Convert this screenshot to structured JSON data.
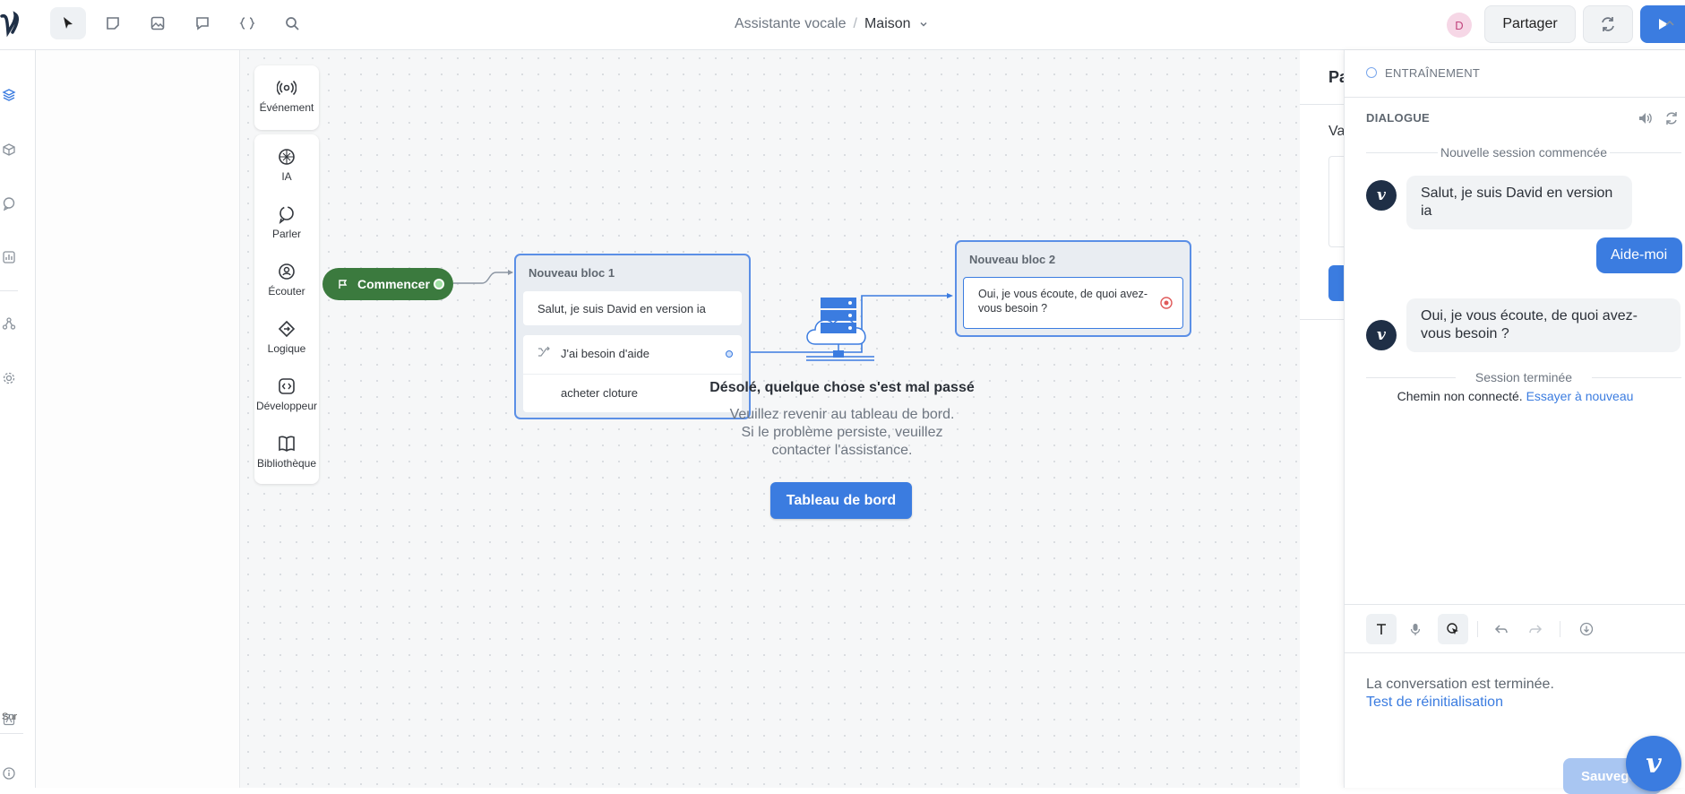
{
  "toolbar": {
    "tools": [
      "select-tool",
      "note-tool",
      "image-tool",
      "comment-tool",
      "variables-tool",
      "search-tool"
    ]
  },
  "breadcrumb": {
    "project": "Assistante vocale",
    "separator": "/",
    "flow": "Maison"
  },
  "header": {
    "avatar_initial": "D",
    "share_label": "Partager"
  },
  "left_rail": {
    "bottom_label": "Sur"
  },
  "palette": {
    "event": "Événement",
    "items": [
      "IA",
      "Parler",
      "Écouter",
      "Logique",
      "Développeur",
      "Bibliothèque"
    ]
  },
  "canvas": {
    "start_label": "Commencer",
    "block1": {
      "title": "Nouveau bloc 1",
      "message": "Salut, je suis David en version ia",
      "intent1": "J'ai besoin d'aide",
      "intent2": "acheter cloture"
    },
    "block2": {
      "title": "Nouveau bloc 2",
      "message": "Oui, je vous écoute, de quoi avez-vous besoin ?"
    }
  },
  "error": {
    "title": "Désolé, quelque chose s'est mal passé",
    "line1": "Veuillez revenir au tableau de bord.",
    "line2": "Si le problème persiste, veuillez",
    "line3": "contacter l'assistance.",
    "button": "Tableau de bord"
  },
  "stub": {
    "title": "Pa",
    "label": "Va"
  },
  "prototype": {
    "section_label": "ENTRAÎNEMENT",
    "dialog_label": "DIALOGUE",
    "session_started": "Nouvelle session commencée",
    "messages": [
      {
        "from": "bot",
        "text": "Salut, je suis David en version ia"
      },
      {
        "from": "user",
        "text": "Aide-moi"
      },
      {
        "from": "bot",
        "text": "Oui, je vous écoute, de quoi avez-vous besoin ?"
      }
    ],
    "session_ended": "Session terminée",
    "not_connected": "Chemin non connecté.",
    "retry": "Essayer à nouveau",
    "ended_text": "La conversation est terminée.",
    "reset_link": "Test de réinitialisation",
    "save_label": "Sauvege",
    "colors": {
      "accent": "#3b7ce0",
      "bot_avatar": "#1f2f46"
    }
  }
}
